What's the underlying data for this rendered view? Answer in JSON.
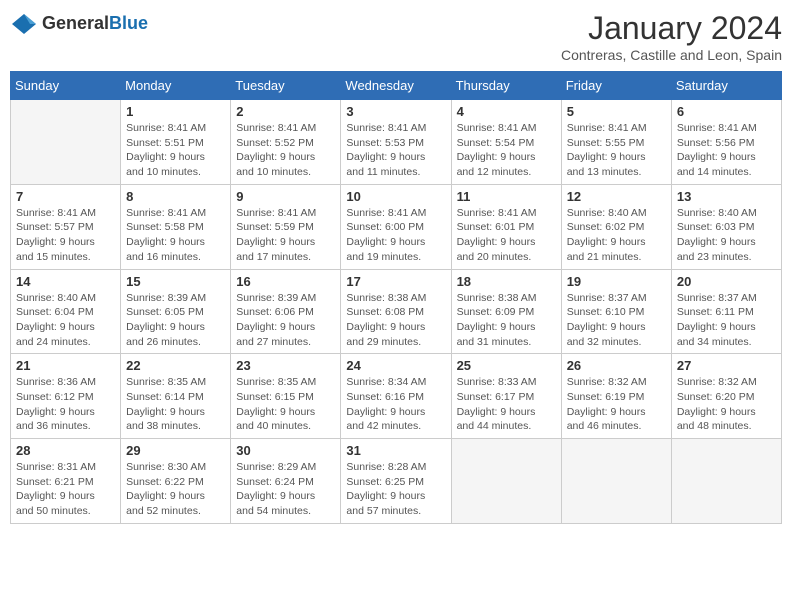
{
  "header": {
    "logo_general": "General",
    "logo_blue": "Blue",
    "month_title": "January 2024",
    "subtitle": "Contreras, Castille and Leon, Spain"
  },
  "days_of_week": [
    "Sunday",
    "Monday",
    "Tuesday",
    "Wednesday",
    "Thursday",
    "Friday",
    "Saturday"
  ],
  "weeks": [
    [
      {
        "num": "",
        "empty": true
      },
      {
        "num": "1",
        "sunrise": "8:41 AM",
        "sunset": "5:51 PM",
        "daylight": "9 hours and 10 minutes."
      },
      {
        "num": "2",
        "sunrise": "8:41 AM",
        "sunset": "5:52 PM",
        "daylight": "9 hours and 10 minutes."
      },
      {
        "num": "3",
        "sunrise": "8:41 AM",
        "sunset": "5:53 PM",
        "daylight": "9 hours and 11 minutes."
      },
      {
        "num": "4",
        "sunrise": "8:41 AM",
        "sunset": "5:54 PM",
        "daylight": "9 hours and 12 minutes."
      },
      {
        "num": "5",
        "sunrise": "8:41 AM",
        "sunset": "5:55 PM",
        "daylight": "9 hours and 13 minutes."
      },
      {
        "num": "6",
        "sunrise": "8:41 AM",
        "sunset": "5:56 PM",
        "daylight": "9 hours and 14 minutes."
      }
    ],
    [
      {
        "num": "7",
        "sunrise": "8:41 AM",
        "sunset": "5:57 PM",
        "daylight": "9 hours and 15 minutes."
      },
      {
        "num": "8",
        "sunrise": "8:41 AM",
        "sunset": "5:58 PM",
        "daylight": "9 hours and 16 minutes."
      },
      {
        "num": "9",
        "sunrise": "8:41 AM",
        "sunset": "5:59 PM",
        "daylight": "9 hours and 17 minutes."
      },
      {
        "num": "10",
        "sunrise": "8:41 AM",
        "sunset": "6:00 PM",
        "daylight": "9 hours and 19 minutes."
      },
      {
        "num": "11",
        "sunrise": "8:41 AM",
        "sunset": "6:01 PM",
        "daylight": "9 hours and 20 minutes."
      },
      {
        "num": "12",
        "sunrise": "8:40 AM",
        "sunset": "6:02 PM",
        "daylight": "9 hours and 21 minutes."
      },
      {
        "num": "13",
        "sunrise": "8:40 AM",
        "sunset": "6:03 PM",
        "daylight": "9 hours and 23 minutes."
      }
    ],
    [
      {
        "num": "14",
        "sunrise": "8:40 AM",
        "sunset": "6:04 PM",
        "daylight": "9 hours and 24 minutes."
      },
      {
        "num": "15",
        "sunrise": "8:39 AM",
        "sunset": "6:05 PM",
        "daylight": "9 hours and 26 minutes."
      },
      {
        "num": "16",
        "sunrise": "8:39 AM",
        "sunset": "6:06 PM",
        "daylight": "9 hours and 27 minutes."
      },
      {
        "num": "17",
        "sunrise": "8:38 AM",
        "sunset": "6:08 PM",
        "daylight": "9 hours and 29 minutes."
      },
      {
        "num": "18",
        "sunrise": "8:38 AM",
        "sunset": "6:09 PM",
        "daylight": "9 hours and 31 minutes."
      },
      {
        "num": "19",
        "sunrise": "8:37 AM",
        "sunset": "6:10 PM",
        "daylight": "9 hours and 32 minutes."
      },
      {
        "num": "20",
        "sunrise": "8:37 AM",
        "sunset": "6:11 PM",
        "daylight": "9 hours and 34 minutes."
      }
    ],
    [
      {
        "num": "21",
        "sunrise": "8:36 AM",
        "sunset": "6:12 PM",
        "daylight": "9 hours and 36 minutes."
      },
      {
        "num": "22",
        "sunrise": "8:35 AM",
        "sunset": "6:14 PM",
        "daylight": "9 hours and 38 minutes."
      },
      {
        "num": "23",
        "sunrise": "8:35 AM",
        "sunset": "6:15 PM",
        "daylight": "9 hours and 40 minutes."
      },
      {
        "num": "24",
        "sunrise": "8:34 AM",
        "sunset": "6:16 PM",
        "daylight": "9 hours and 42 minutes."
      },
      {
        "num": "25",
        "sunrise": "8:33 AM",
        "sunset": "6:17 PM",
        "daylight": "9 hours and 44 minutes."
      },
      {
        "num": "26",
        "sunrise": "8:32 AM",
        "sunset": "6:19 PM",
        "daylight": "9 hours and 46 minutes."
      },
      {
        "num": "27",
        "sunrise": "8:32 AM",
        "sunset": "6:20 PM",
        "daylight": "9 hours and 48 minutes."
      }
    ],
    [
      {
        "num": "28",
        "sunrise": "8:31 AM",
        "sunset": "6:21 PM",
        "daylight": "9 hours and 50 minutes."
      },
      {
        "num": "29",
        "sunrise": "8:30 AM",
        "sunset": "6:22 PM",
        "daylight": "9 hours and 52 minutes."
      },
      {
        "num": "30",
        "sunrise": "8:29 AM",
        "sunset": "6:24 PM",
        "daylight": "9 hours and 54 minutes."
      },
      {
        "num": "31",
        "sunrise": "8:28 AM",
        "sunset": "6:25 PM",
        "daylight": "9 hours and 57 minutes."
      },
      {
        "num": "",
        "empty": true
      },
      {
        "num": "",
        "empty": true
      },
      {
        "num": "",
        "empty": true
      }
    ]
  ],
  "labels": {
    "sunrise": "Sunrise:",
    "sunset": "Sunset:",
    "daylight": "Daylight:"
  }
}
